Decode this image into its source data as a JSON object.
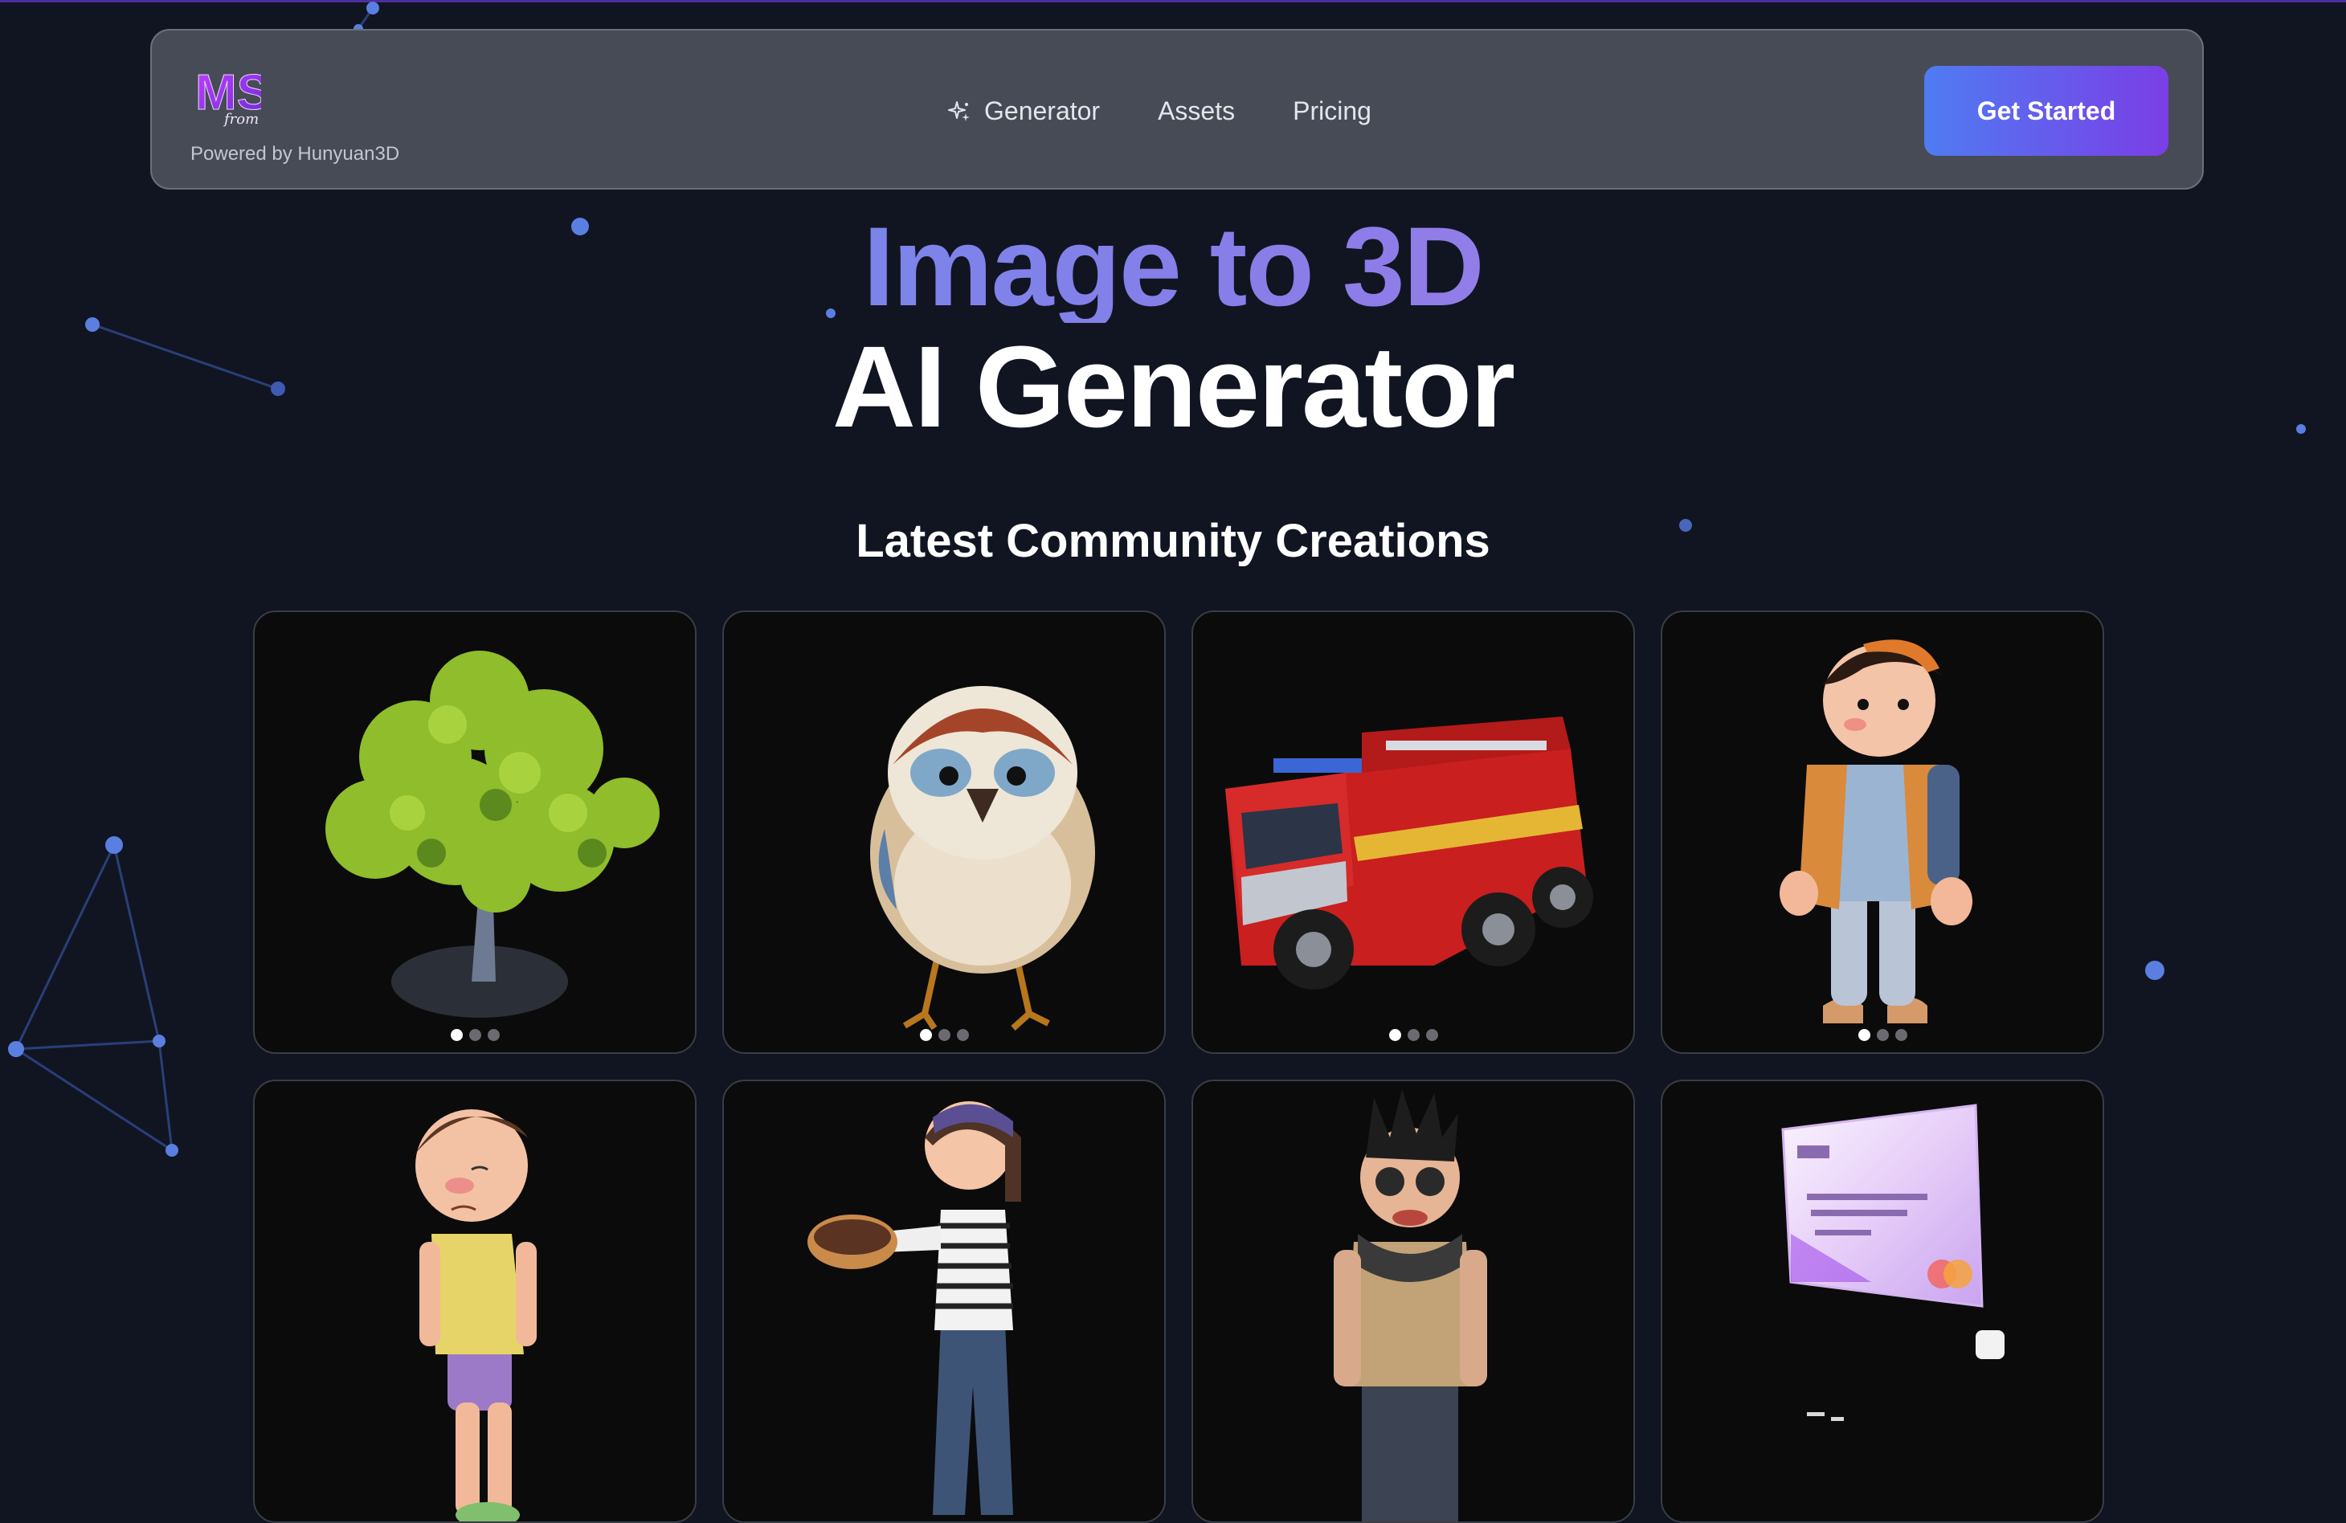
{
  "header": {
    "logo_text": "MS",
    "logo_subtext": "from",
    "powered_by": "Powered by Hunyuan3D",
    "nav": [
      {
        "label": "Generator",
        "icon": "sparkles-icon"
      },
      {
        "label": "Assets"
      },
      {
        "label": "Pricing"
      }
    ],
    "cta_label": "Get Started"
  },
  "hero": {
    "line1": "Image to 3D",
    "line2": "AI Generator"
  },
  "community": {
    "title": "Latest Community Creations",
    "items": [
      {
        "subject": "tree",
        "slides": 3,
        "active_slide": 1
      },
      {
        "subject": "sparrow",
        "slides": 3,
        "active_slide": 1
      },
      {
        "subject": "fire-truck",
        "slides": 3,
        "active_slide": 1
      },
      {
        "subject": "boy-with-backpack",
        "slides": 3,
        "active_slide": 1
      },
      {
        "subject": "sad-boy"
      },
      {
        "subject": "woman-with-donut"
      },
      {
        "subject": "punk-character"
      },
      {
        "subject": "credit-card"
      }
    ]
  },
  "colors": {
    "background": "#111522",
    "accent_start": "#4f7cf2",
    "accent_end": "#7a3ee6",
    "navbar_bg": "#474b55"
  }
}
